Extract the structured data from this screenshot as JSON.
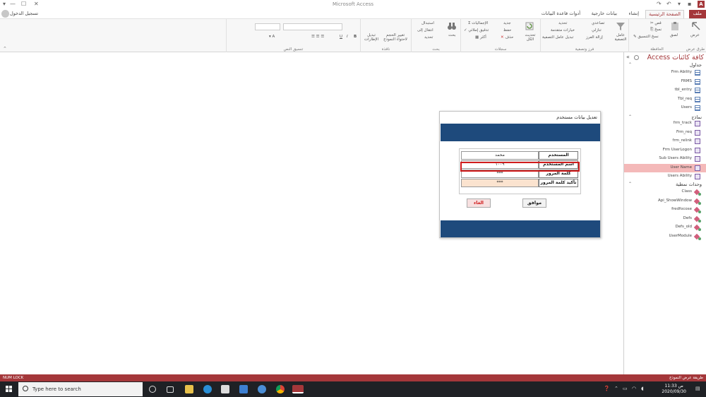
{
  "window": {
    "title": "Microsoft Access",
    "app_icon": "A",
    "qat_icons": [
      "save-icon",
      "undo-icon",
      "redo-icon",
      "customize-icon"
    ],
    "controls": [
      "?",
      "—",
      "☐",
      "✕"
    ]
  },
  "tabs": {
    "file": "ملف",
    "home": "الصفحة الرئيسية",
    "create": "إنشاء",
    "external": "بيانات خارجية",
    "dbtools": "أدوات قاعدة البيانات",
    "signin": "تسجيل الدخول"
  },
  "ribbon": {
    "groups": {
      "views": "طرق عرض",
      "clipboard": "الحافظة",
      "sort_filter": "فرز وتصفية",
      "records": "سجلات",
      "find": "بحث",
      "window": "نافذة",
      "text_format": "تنسيق النص"
    },
    "views": {
      "view_label": "عرض"
    },
    "clipboard": {
      "paste": "لصق",
      "cut": "قص",
      "copy": "نسخ",
      "format_painter": "نسخ التنسيق"
    },
    "sort_filter": {
      "filter": "عامل التصفية",
      "ascending": "تصاعدي",
      "descending": "تنازلي",
      "remove_sort": "إزالة الفرز",
      "selection": "تحديد",
      "advanced": "خيارات متقدمة",
      "toggle_filter": "تبديل عامل التصفية"
    },
    "records": {
      "refresh_all": "تحديث الكل",
      "new": "جديد",
      "save": "حفظ",
      "delete": "حذف",
      "totals": "الإجماليات",
      "spelling": "تدقيق إملائي",
      "more": "أكثر"
    },
    "find": {
      "find": "بحث",
      "replace": "استبدال",
      "goto": "انتقال إلى",
      "select": "تحديد"
    },
    "window": {
      "size_to_fit": "تغيير الحجم لاحتواء النموذج",
      "switch_windows": "تبديل الإطارات"
    },
    "text_format": {
      "bold": "B",
      "italic": "I",
      "underline": "U"
    }
  },
  "nav": {
    "title": "كافة كائنات Access",
    "collapse": "«",
    "sections": {
      "tables": "جداول",
      "forms": "نماذج",
      "modules": "وحدات نمطية"
    },
    "tables": [
      "Frm Ability",
      "FRMS",
      "tbl_entry",
      "Tbl_req",
      "Users"
    ],
    "forms": [
      "frm_track",
      "Frm_req",
      "frm_relink",
      "Frm UserLogon",
      "Sub Users Ability",
      "User Name",
      "Users Ability"
    ],
    "modules": [
      "Class",
      "Api_ShowWindow",
      "fredfocose",
      "Defs",
      "Defs_old",
      "UserModule"
    ]
  },
  "dialog": {
    "title": "تعديل بيانات مستخدم",
    "rows": [
      {
        "label": "المستخدم",
        "value": "محمد"
      },
      {
        "label": "اسم المستخدم",
        "value": "١٠٠٩"
      },
      {
        "label": "كلمة المرور",
        "value": "***"
      },
      {
        "label": "تأكيد كلمة المرور",
        "value": "***"
      }
    ],
    "ok": "موافق",
    "cancel": "الغاء"
  },
  "status": {
    "left": "NUM LOCK",
    "right": "طريقة عرض النموذج"
  },
  "taskbar": {
    "search_placeholder": "Type here to search",
    "time": "11:33 ص",
    "date": "2020/09/30"
  },
  "colors": {
    "accent": "#a4373a",
    "dialog_band": "#1e4a7c",
    "highlight": "#d01c1c",
    "nav_selected": "#f4b9b9"
  }
}
